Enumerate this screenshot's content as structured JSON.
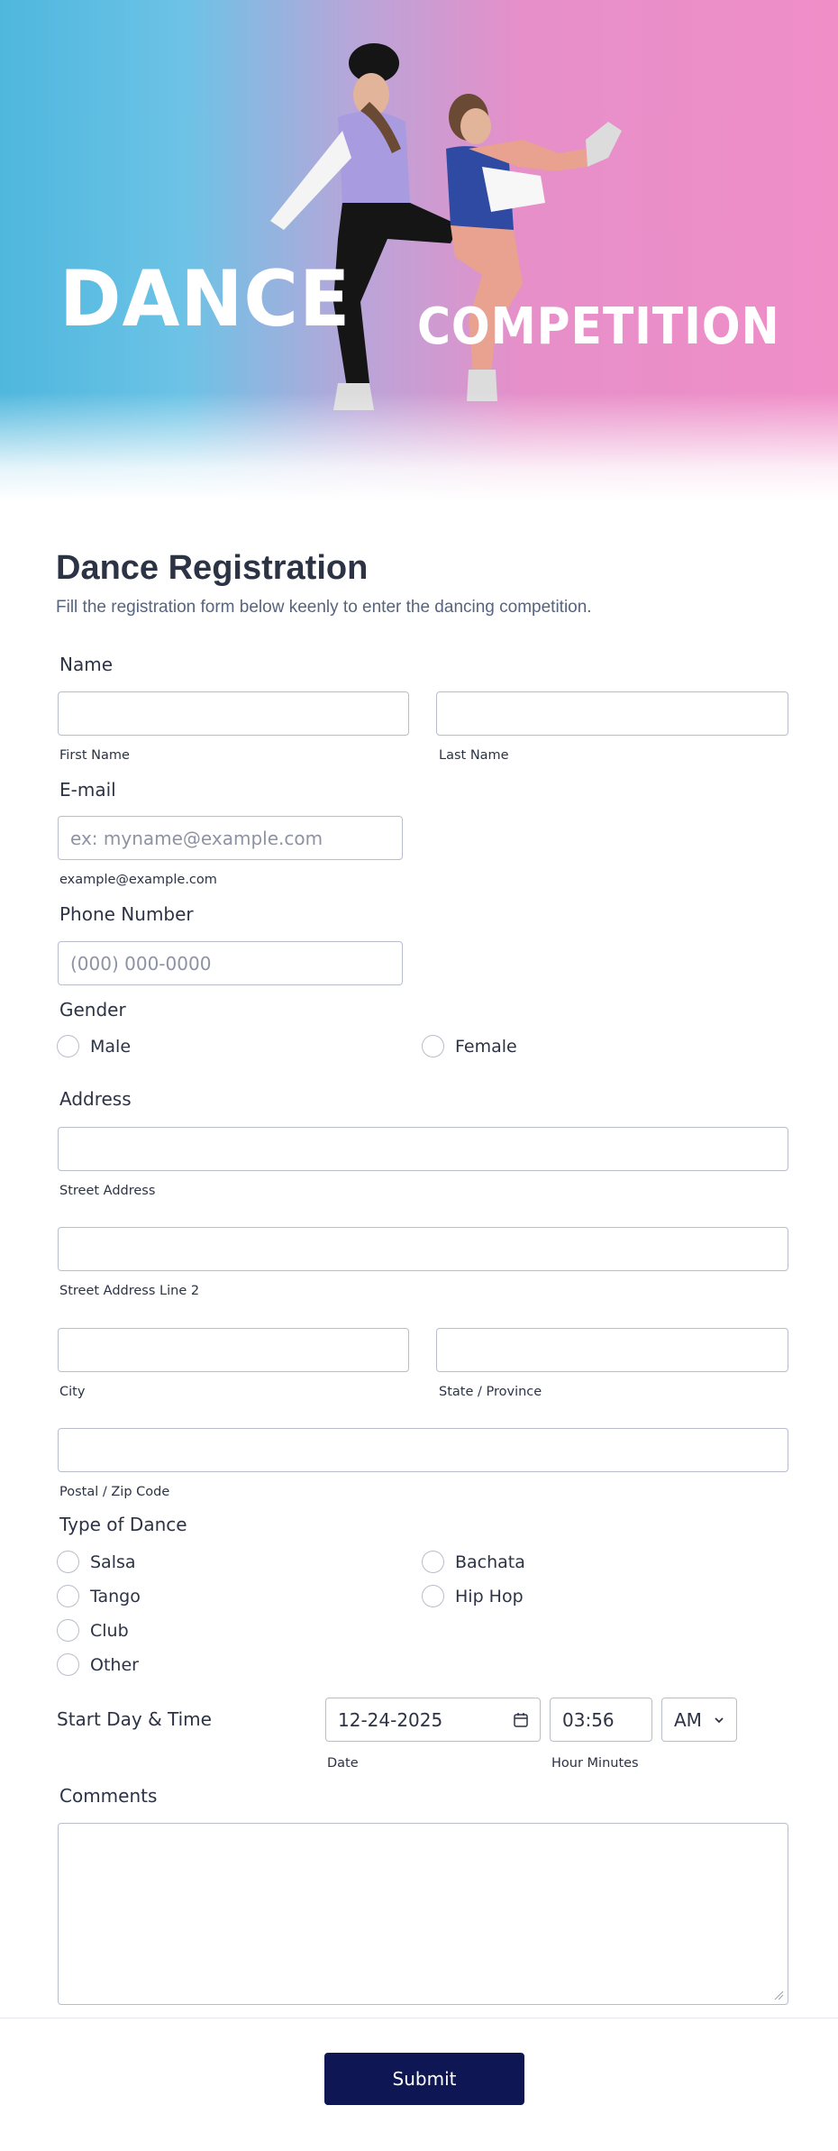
{
  "hero": {
    "title_1": "DANCE",
    "title_2": "COMPETITION"
  },
  "form": {
    "title": "Dance Registration",
    "subtitle": "Fill the registration form below keenly to enter the dancing competition.",
    "name": {
      "label": "Name",
      "first_sublabel": "First Name",
      "last_sublabel": "Last Name",
      "first_value": "",
      "last_value": ""
    },
    "email": {
      "label": "E-mail",
      "placeholder": "ex: myname@example.com",
      "sublabel": "example@example.com",
      "value": ""
    },
    "phone": {
      "label": "Phone Number",
      "placeholder": "(000) 000-0000",
      "value": ""
    },
    "gender": {
      "label": "Gender",
      "options": [
        "Male",
        "Female"
      ]
    },
    "address": {
      "label": "Address",
      "street_sublabel": "Street Address",
      "street2_sublabel": "Street Address Line 2",
      "city_sublabel": "City",
      "state_sublabel": "State / Province",
      "zip_sublabel": "Postal / Zip Code"
    },
    "dance_type": {
      "label": "Type of Dance",
      "options": [
        "Salsa",
        "Bachata",
        "Tango",
        "Hip Hop",
        "Club",
        "Other"
      ]
    },
    "start": {
      "label": "Start Day & Time",
      "date_value": "12-24-2025",
      "date_sublabel": "Date",
      "time_value": "03:56",
      "time_sublabel": "Hour Minutes",
      "ampm_value": "AM"
    },
    "comments": {
      "label": "Comments",
      "value": ""
    },
    "submit_label": "Submit"
  },
  "colors": {
    "hero_left": "#4fb7dd",
    "hero_right": "#f08ec8",
    "submit_bg": "#0f1654",
    "text": "#2c3345",
    "border": "#b8bdc9"
  },
  "icons": {
    "date": "calendar-icon",
    "ampm": "chevron-down-icon",
    "textarea_resize": "resize-handle-icon"
  }
}
